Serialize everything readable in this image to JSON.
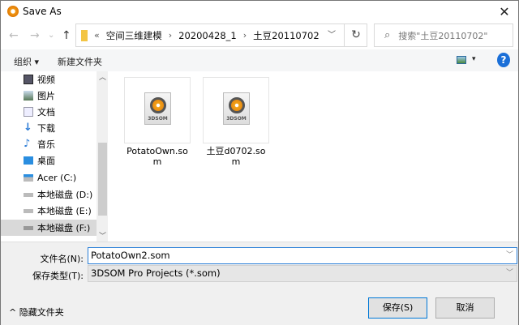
{
  "window": {
    "title": "Save As",
    "close": "✕"
  },
  "nav": {
    "back": "←",
    "forward": "→",
    "recent": "⌄",
    "up": "↑",
    "breadcrumb": [
      "«",
      "空间三维建模",
      "20200428_1",
      "土豆20110702"
    ],
    "refresh": "↻",
    "search_placeholder": "搜索\"土豆20110702\""
  },
  "toolbar": {
    "organize": "组织 ▾",
    "new_folder": "新建文件夹",
    "help": "?",
    "view_drop": "▾"
  },
  "sidebar": {
    "items": [
      {
        "label": "视频",
        "icon": "video-icon"
      },
      {
        "label": "图片",
        "icon": "pictures-icon"
      },
      {
        "label": "文档",
        "icon": "documents-icon"
      },
      {
        "label": "下载",
        "icon": "download-icon"
      },
      {
        "label": "音乐",
        "icon": "music-icon"
      },
      {
        "label": "桌面",
        "icon": "desktop-icon"
      },
      {
        "label": "Acer (C:)",
        "icon": "drive-icon"
      },
      {
        "label": "本地磁盘 (D:)",
        "icon": "drive-icon"
      },
      {
        "label": "本地磁盘 (E:)",
        "icon": "drive-icon"
      },
      {
        "label": "本地磁盘 (F:)",
        "icon": "drive-icon",
        "selected": true
      }
    ]
  },
  "files": [
    {
      "name": "PotatoOwn.som",
      "badge": "3DSOM"
    },
    {
      "name": "土豆d0702.som",
      "badge": "3DSOM"
    }
  ],
  "form": {
    "filename_label": "文件名(N):",
    "filename_value": "PotatoOwn2.som",
    "type_label": "保存类型(T):",
    "type_value": "3DSOM Pro Projects (*.som)"
  },
  "footer": {
    "hide_folders": "隐藏文件夹",
    "save": "保存(S)",
    "cancel": "取消"
  }
}
